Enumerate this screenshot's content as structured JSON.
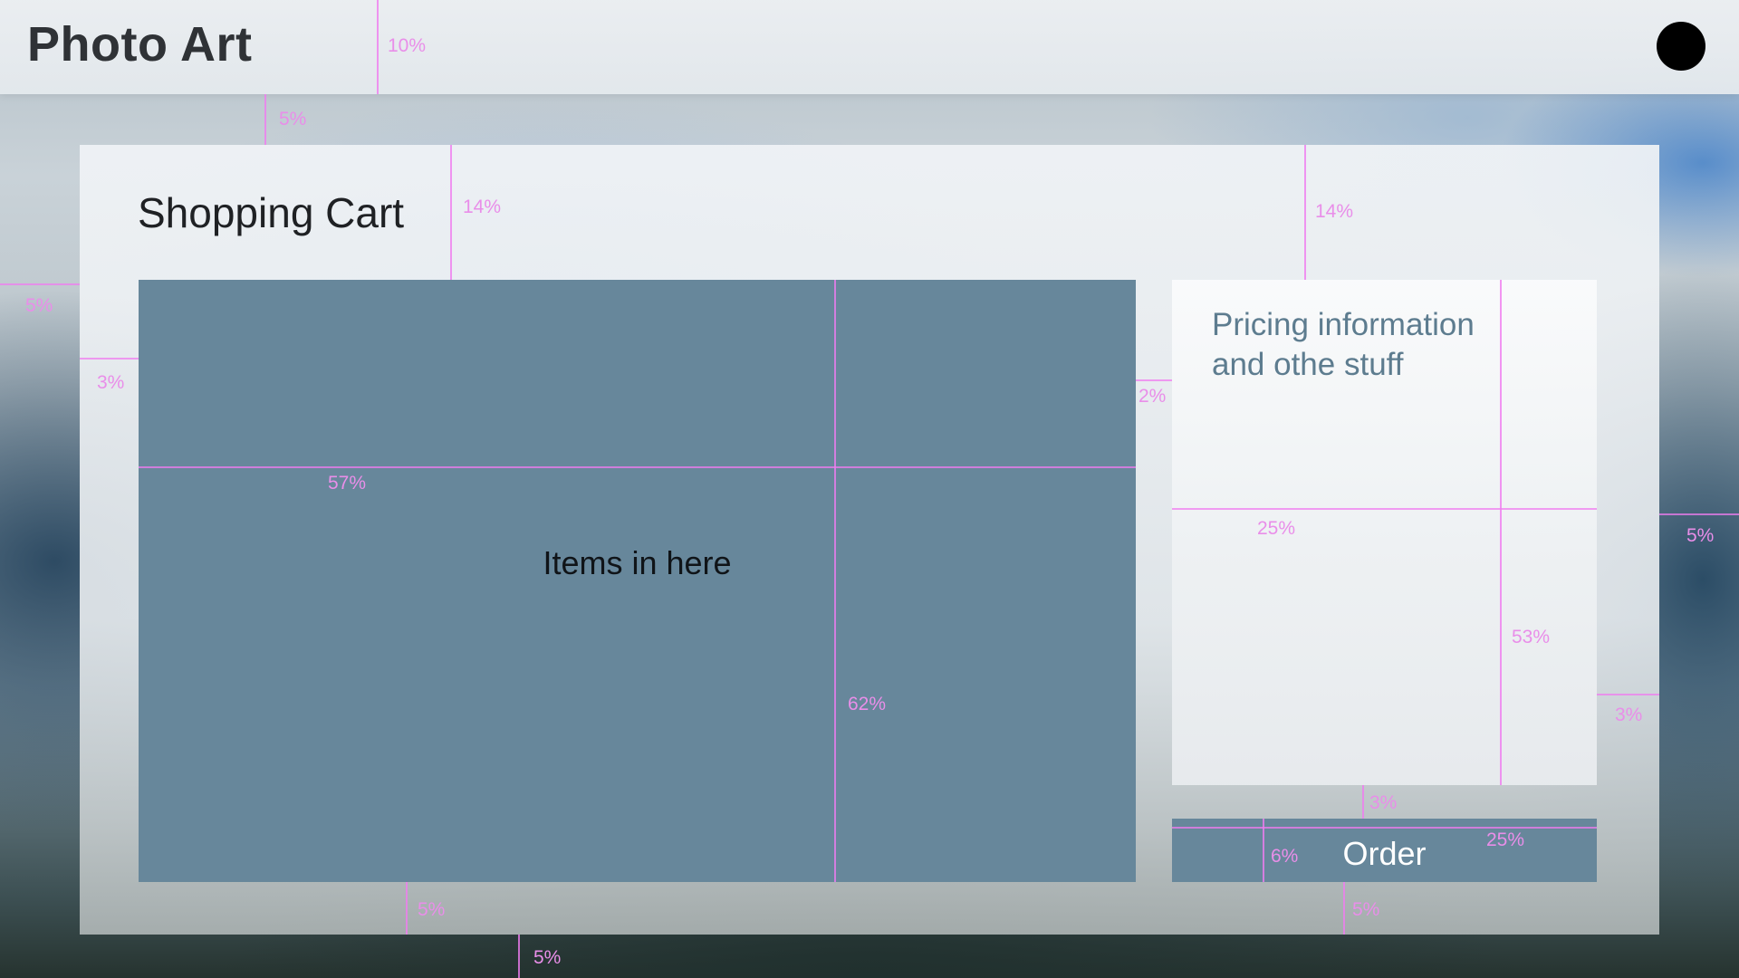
{
  "app": {
    "title": "Photo Art"
  },
  "cart": {
    "title": "Shopping Cart",
    "items_placeholder": "Items in here",
    "pricing_placeholder": "Pricing information and othe stuff",
    "pricing_lines": [
      "Pricing information",
      "and othe stuff"
    ],
    "order_label": "Order"
  },
  "guides": {
    "color": "#f07cf0",
    "labels": [
      "10%",
      "5%",
      "14%",
      "14%",
      "5%",
      "3%",
      "2%",
      "57%",
      "25%",
      "5%",
      "53%",
      "62%",
      "3%",
      "3%",
      "6%",
      "25%",
      "5%",
      "5%",
      "5%"
    ]
  },
  "colors": {
    "accent": "#67879b",
    "panel": "#eef1f4",
    "pricing_text": "#5d7c8f",
    "title_text": "#2f3236",
    "avatar": "#000000",
    "guide": "#f07cf0"
  }
}
